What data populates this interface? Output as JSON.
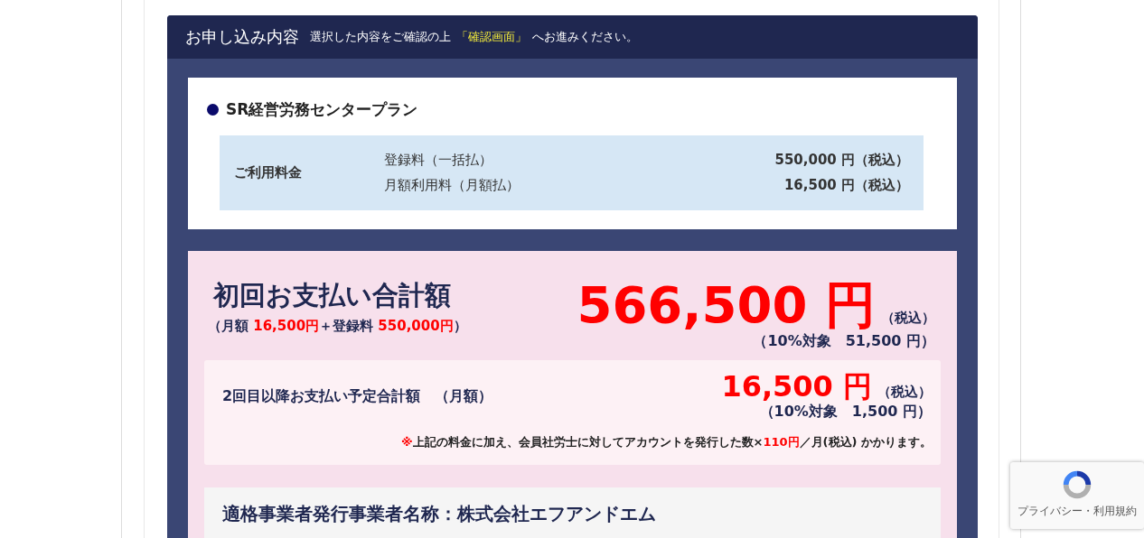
{
  "header": {
    "title": "お申し込み内容",
    "subtitle": [
      {
        "text": "選択した内容をご確認の上",
        "highlight": false
      },
      {
        "text": "「確認画面」",
        "highlight": true
      },
      {
        "text": "へお進みください。",
        "highlight": false
      }
    ]
  },
  "plan": {
    "name": "SR経営労務センタープラン",
    "fee_label": "ご利用料金",
    "fees": [
      {
        "item": "登録料（一括払）",
        "amount": "550,000 円（税込）"
      },
      {
        "item": "月額利用料（月額払）",
        "amount": "16,500 円（税込）"
      }
    ]
  },
  "first_payment": {
    "title": "初回お支払い合計額",
    "breakdown": [
      {
        "text": "（月額 ",
        "highlight": false
      },
      {
        "text": "16,500円",
        "highlight": true
      },
      {
        "text": "＋登録料 ",
        "highlight": false
      },
      {
        "text": "550,000円",
        "highlight": true
      },
      {
        "text": "）",
        "highlight": false
      }
    ],
    "amount": "566,500 円",
    "tax_note": "（税込）",
    "tax_detail": "（10%対象　51,500 円）"
  },
  "recurring_payment": {
    "title": "2回目以降お支払い予定合計額　（月額）",
    "amount": "16,500 円",
    "tax_note": "（税込）",
    "tax_detail": "（10%対象　1,500 円）",
    "note": [
      {
        "text": "※",
        "highlight": true
      },
      {
        "text": "上記の料金に加え、会員社労士に対してアカウントを発行した数×",
        "highlight": false
      },
      {
        "text": "110円",
        "highlight": true
      },
      {
        "text": "／月(税込) かかります。",
        "highlight": false
      }
    ]
  },
  "issuer": {
    "label": "適格事業者発行事業者名称：株式会社エフアンドエム"
  },
  "recaptcha": {
    "links": "プライバシー・利用規約"
  }
}
